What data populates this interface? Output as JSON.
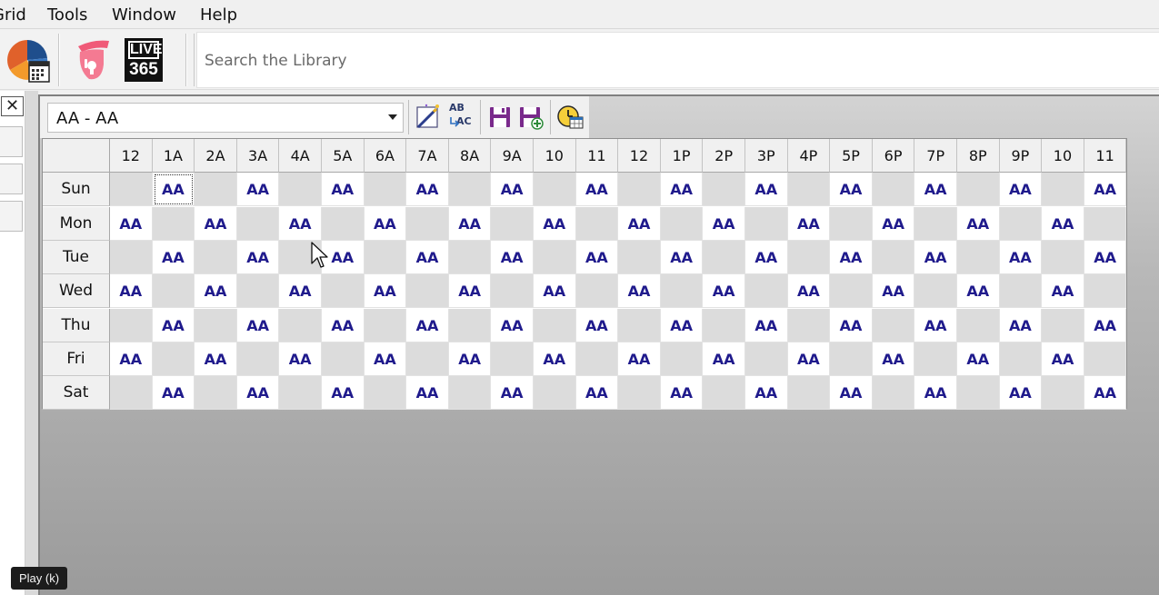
{
  "menu": [
    "Grid",
    "Tools",
    "Window",
    "Help"
  ],
  "toolbar": {
    "icons": [
      "pie-chart-calendar-icon",
      "pink-podcast-mic-icon",
      "live365-logo-icon"
    ],
    "logo_text_line1": "LIVE",
    "logo_text_line2": "365",
    "search_placeholder": "Search the Library"
  },
  "panel": {
    "close_label": "✕"
  },
  "grid_toolbar": {
    "selected_clock": "AA - AA",
    "buttons": [
      "magic-wand-icon",
      "rename-abc-icon",
      "save-icon",
      "save-as-icon",
      "clock-grid-icon"
    ],
    "abc_top": "AB",
    "abc_bottom": "AC"
  },
  "schedule": {
    "hours": [
      "12",
      "1A",
      "2A",
      "3A",
      "4A",
      "5A",
      "6A",
      "7A",
      "8A",
      "9A",
      "10",
      "11",
      "12",
      "1P",
      "2P",
      "3P",
      "4P",
      "5P",
      "6P",
      "7P",
      "8P",
      "9P",
      "10",
      "11"
    ],
    "days": [
      "Sun",
      "Mon",
      "Tue",
      "Wed",
      "Thu",
      "Fri",
      "Sat"
    ],
    "clock_label": "AA",
    "rows": [
      [
        "",
        "AA",
        "",
        "AA",
        "",
        "AA",
        "",
        "AA",
        "",
        "AA",
        "",
        "AA",
        "",
        "AA",
        "",
        "AA",
        "",
        "AA",
        "",
        "AA",
        "",
        "AA",
        "",
        "AA"
      ],
      [
        "AA",
        "",
        "AA",
        "",
        "AA",
        "",
        "AA",
        "",
        "AA",
        "",
        "AA",
        "",
        "AA",
        "",
        "AA",
        "",
        "AA",
        "",
        "AA",
        "",
        "AA",
        "",
        "AA",
        ""
      ],
      [
        "",
        "AA",
        "",
        "AA",
        "",
        "AA",
        "",
        "AA",
        "",
        "AA",
        "",
        "AA",
        "",
        "AA",
        "",
        "AA",
        "",
        "AA",
        "",
        "AA",
        "",
        "AA",
        "",
        "AA"
      ],
      [
        "AA",
        "",
        "AA",
        "",
        "AA",
        "",
        "AA",
        "",
        "AA",
        "",
        "AA",
        "",
        "AA",
        "",
        "AA",
        "",
        "AA",
        "",
        "AA",
        "",
        "AA",
        "",
        "AA",
        ""
      ],
      [
        "",
        "AA",
        "",
        "AA",
        "",
        "AA",
        "",
        "AA",
        "",
        "AA",
        "",
        "AA",
        "",
        "AA",
        "",
        "AA",
        "",
        "AA",
        "",
        "AA",
        "",
        "AA",
        "",
        "AA"
      ],
      [
        "AA",
        "",
        "AA",
        "",
        "AA",
        "",
        "AA",
        "",
        "AA",
        "",
        "AA",
        "",
        "AA",
        "",
        "AA",
        "",
        "AA",
        "",
        "AA",
        "",
        "AA",
        "",
        "AA",
        ""
      ],
      [
        "",
        "AA",
        "",
        "AA",
        "",
        "AA",
        "",
        "AA",
        "",
        "AA",
        "",
        "AA",
        "",
        "AA",
        "",
        "AA",
        "",
        "AA",
        "",
        "AA",
        "",
        "AA",
        "",
        "AA"
      ]
    ],
    "selected_day": "Sun",
    "selected_hour": "1A"
  },
  "tooltip": "Play (k)"
}
